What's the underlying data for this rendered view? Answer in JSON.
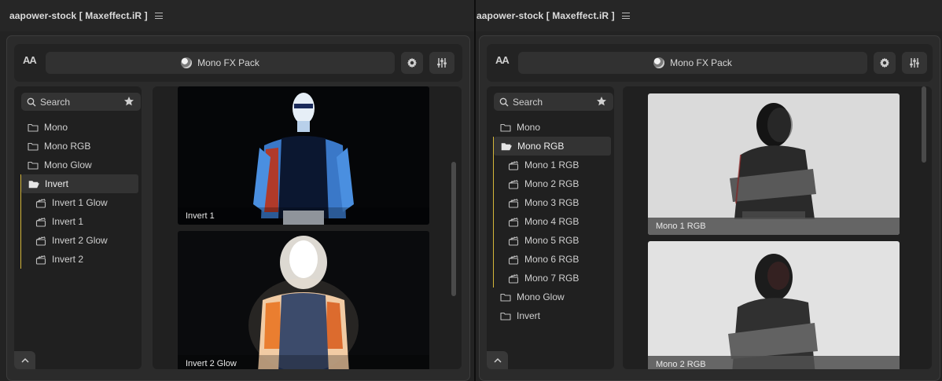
{
  "left": {
    "window_title": "aapower-stock [ Maxeffect.iR ]",
    "toolbar": {
      "aa_label": "AA",
      "title": "Mono FX Pack"
    },
    "search": {
      "label": "Search"
    },
    "tree": [
      {
        "label": "Mono"
      },
      {
        "label": "Mono RGB"
      },
      {
        "label": "Mono Glow"
      },
      {
        "label": "Invert"
      },
      {
        "label": "Invert 1 Glow"
      },
      {
        "label": "Invert 1"
      },
      {
        "label": "Invert 2 Glow"
      },
      {
        "label": "Invert 2"
      }
    ],
    "thumbs": [
      {
        "caption": "Invert 1"
      },
      {
        "caption": "Invert 2 Glow"
      }
    ]
  },
  "right": {
    "window_title": "aapower-stock [ Maxeffect.iR ]",
    "toolbar": {
      "aa_label": "AA",
      "title": "Mono FX Pack"
    },
    "search": {
      "label": "Search"
    },
    "tree": [
      {
        "label": "Mono"
      },
      {
        "label": "Mono RGB"
      },
      {
        "label": "Mono 1 RGB"
      },
      {
        "label": "Mono 2 RGB"
      },
      {
        "label": "Mono 3 RGB"
      },
      {
        "label": "Mono 4 RGB"
      },
      {
        "label": "Mono 5 RGB"
      },
      {
        "label": "Mono 6 RGB"
      },
      {
        "label": "Mono 7 RGB"
      },
      {
        "label": "Mono Glow"
      },
      {
        "label": "Invert"
      }
    ],
    "thumbs": [
      {
        "caption": "Mono 1 RGB"
      },
      {
        "caption": "Mono 2 RGB"
      }
    ]
  },
  "colors": {
    "accent": "#d4b63a",
    "panel": "#2b2b2b",
    "background": "#1a1a1a"
  }
}
